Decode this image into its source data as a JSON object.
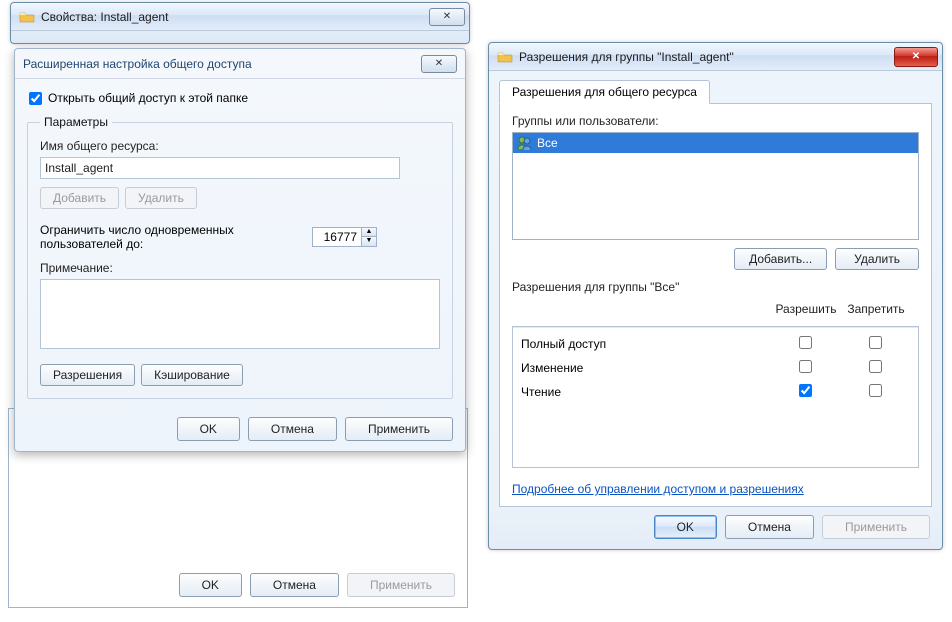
{
  "back_window": {
    "ok": "OK",
    "cancel": "Отмена",
    "apply": "Применить"
  },
  "props_window": {
    "title": "Свойства: Install_agent"
  },
  "adv_dialog": {
    "title": "Расширенная настройка общего доступа",
    "share_checkbox": "Открыть общий доступ к этой папке",
    "params_legend": "Параметры",
    "share_name_label": "Имя общего ресурса:",
    "share_name_value": "Install_agent",
    "add": "Добавить",
    "remove": "Удалить",
    "limit_label": "Ограничить число одновременных пользователей до:",
    "limit_value": "16777",
    "note_label": "Примечание:",
    "note_value": "",
    "permissions_btn": "Разрешения",
    "caching_btn": "Кэширование",
    "ok": "OK",
    "cancel": "Отмена",
    "apply": "Применить"
  },
  "perm_window": {
    "title": "Разрешения для группы \"Install_agent\"",
    "tab": "Разрешения для общего ресурса",
    "groups_label": "Группы или пользователи:",
    "user_everyone": "Все",
    "add": "Добавить...",
    "remove": "Удалить",
    "perm_for_label": "Разрешения для группы \"Все\"",
    "col_allow": "Разрешить",
    "col_deny": "Запретить",
    "perm_full": "Полный доступ",
    "perm_change": "Изменение",
    "perm_read": "Чтение",
    "learn_more": "Подробнее об управлении доступом и разрешениях",
    "ok": "OK",
    "cancel": "Отмена",
    "apply": "Применить"
  }
}
